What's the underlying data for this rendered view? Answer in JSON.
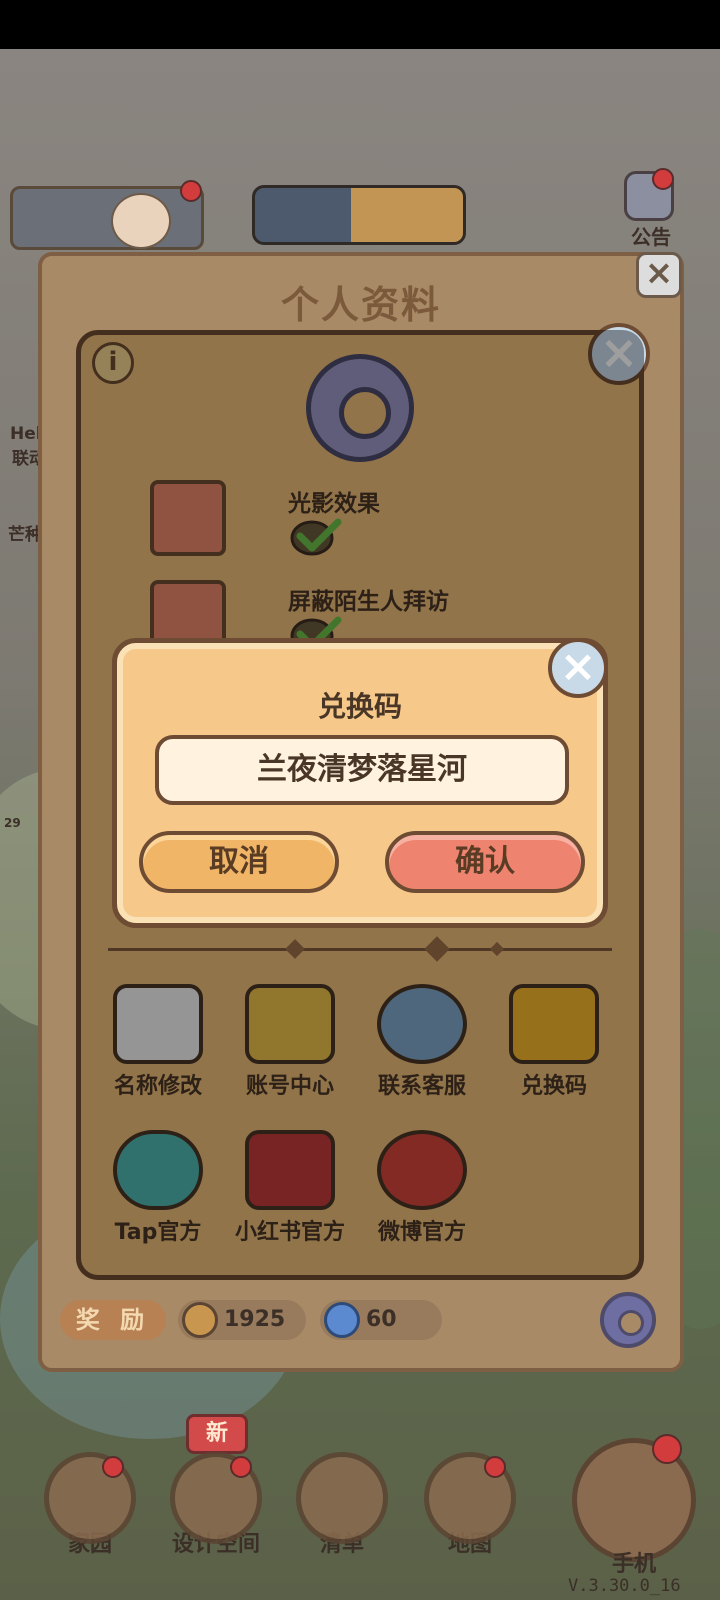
{
  "hud": {
    "notice_label": "公告",
    "side_labels": [
      "Hel",
      "联动",
      "芒种"
    ],
    "side_count": "29"
  },
  "profile": {
    "title": "个人资料",
    "reward_label": "奖 励",
    "currency_coins": "1925",
    "currency_swirl": "60"
  },
  "settings": {
    "info_icon": "info-icon",
    "options": [
      {
        "label": "光影效果",
        "checked": true
      },
      {
        "label": "屏蔽陌生人拜访",
        "checked": true
      }
    ],
    "tools": [
      {
        "label": "名称修改",
        "icon": "pencil-icon"
      },
      {
        "label": "账号中心",
        "icon": "key-icon"
      },
      {
        "label": "联系客服",
        "icon": "headset-icon"
      },
      {
        "label": "兑换码",
        "icon": "ticket-icon"
      },
      {
        "label": "Tap官方",
        "icon": "tap-icon"
      },
      {
        "label": "小红书官方",
        "icon": "xiaohongshu-icon"
      },
      {
        "label": "微博官方",
        "icon": "weibo-icon"
      }
    ]
  },
  "redeem_dialog": {
    "title": "兑换码",
    "code_value": "兰夜清梦落星河",
    "cancel_label": "取消",
    "confirm_label": "确认"
  },
  "bottom_nav": {
    "items": [
      {
        "label": "家园"
      },
      {
        "label": "设计空间"
      },
      {
        "label": "清单"
      },
      {
        "label": "地图"
      }
    ],
    "new_badge": "新",
    "phone_label": "手机"
  },
  "version": "V.3.30.0_16",
  "colors": {
    "panel": "#ecbb78",
    "panel_border": "#6e4c33",
    "dialog": "#f6c88a",
    "confirm": "#ee8470",
    "cancel": "#f1b567",
    "badge_red": "#d23c3c"
  }
}
